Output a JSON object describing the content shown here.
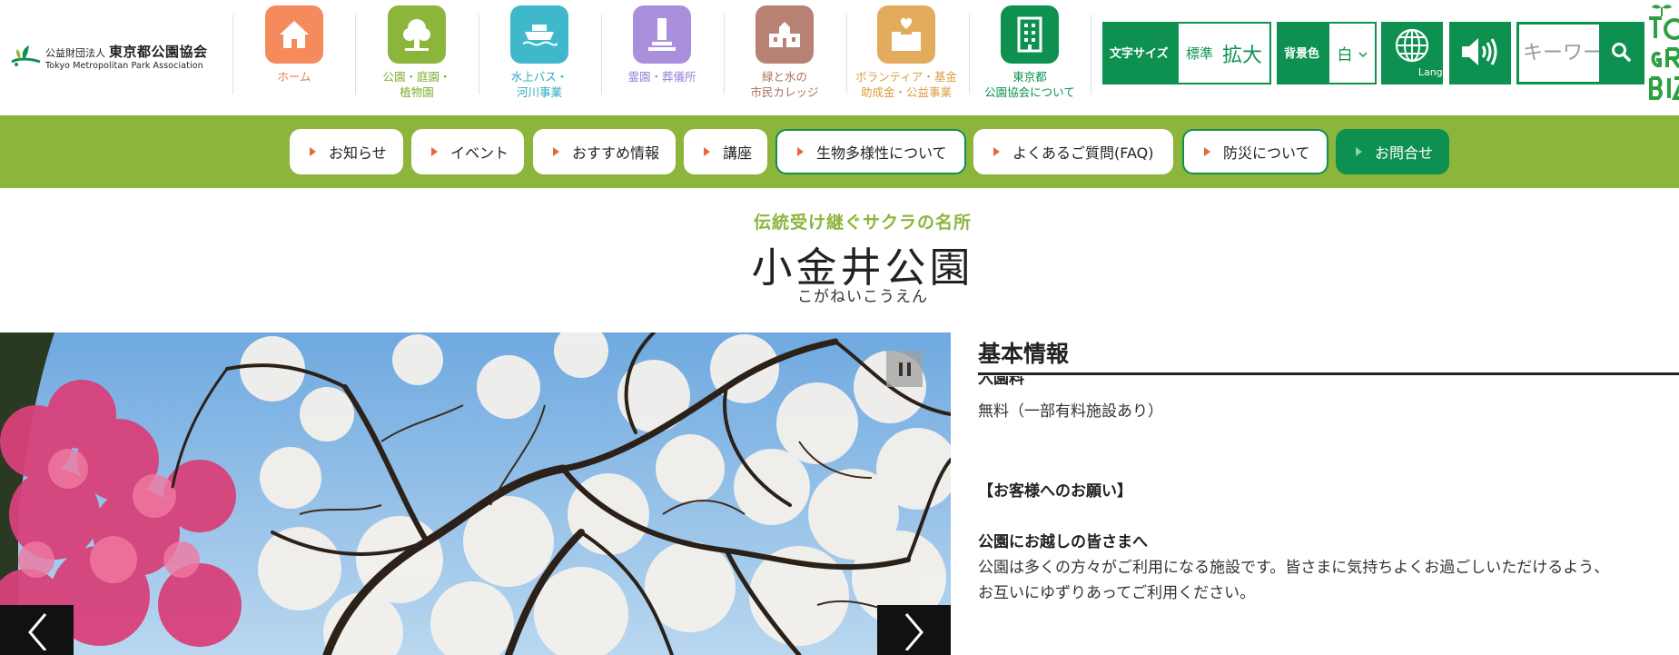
{
  "logo": {
    "corp": "公益財団法人",
    "name": "東京都公園協会",
    "en": "Tokyo Metropolitan Park Association"
  },
  "global_nav": [
    {
      "label": "ホーム",
      "icon": "house-icon",
      "color": "#f58a5d",
      "text_color": "#f07a46"
    },
    {
      "label": "公園・庭園・\n植物園",
      "icon": "tree-icon",
      "color": "#8cb53c",
      "text_color": "#7fae30"
    },
    {
      "label": "水上バス・\n河川事業",
      "icon": "boat-icon",
      "color": "#3fb8cc",
      "text_color": "#2ba9c0"
    },
    {
      "label": "霊園・葬儀所",
      "icon": "tombstone-icon",
      "color": "#a98fdc",
      "text_color": "#9a7fd6"
    },
    {
      "label": "緑と水の\n市民カレッジ",
      "icon": "school-icon",
      "color": "#b78274",
      "text_color": "#a8705f"
    },
    {
      "label": "ボランティア・基金\n助成金・公益事業",
      "icon": "donation-box-icon",
      "color": "#e3ab5c",
      "text_color": "#dd9c3f"
    },
    {
      "label": "東京都\n公園協会について",
      "icon": "building-icon",
      "color": "#0e9150",
      "text_color": "#0e9150"
    }
  ],
  "tools": {
    "font_size_label": "文字サイズ",
    "font_size_standard": "標準",
    "font_size_large": "拡大",
    "bg_color_label": "背景色",
    "bg_color_value": "白",
    "language_label": "Language",
    "search_placeholder": "キーワード"
  },
  "sub_nav": [
    {
      "label": "お知らせ",
      "style": "plain"
    },
    {
      "label": "イベント",
      "style": "plain"
    },
    {
      "label": "おすすめ情報",
      "style": "plain"
    },
    {
      "label": "講座",
      "style": "plain"
    },
    {
      "label": "生物多様性について",
      "style": "outline"
    },
    {
      "label": "よくあるご質問(FAQ)",
      "style": "plain"
    },
    {
      "label": "防災について",
      "style": "outline"
    },
    {
      "label": "お問合せ",
      "style": "green"
    }
  ],
  "page": {
    "catch": "伝統受け継ぐサクラの名所",
    "title": "小金井公園",
    "kana": "こがねいこうえん"
  },
  "info": {
    "heading": "基本情報",
    "clipped_label": "入園料",
    "fee": "無料（一部有料施設あり）",
    "request_heading": "【お客様へのお願い】",
    "to_visitors": "公園にお越しの皆さまへ",
    "para_line1": "公園は多くの方々がご利用になる施設です。皆さまに気持ちよくお過ごしいただけるよう、",
    "para_line2": "お互いにゆずりあってご利用ください。"
  },
  "colors": {
    "brand_green": "#0e9150",
    "subnav_green": "#8cb53c",
    "arrow_orange": "#e8673c"
  }
}
